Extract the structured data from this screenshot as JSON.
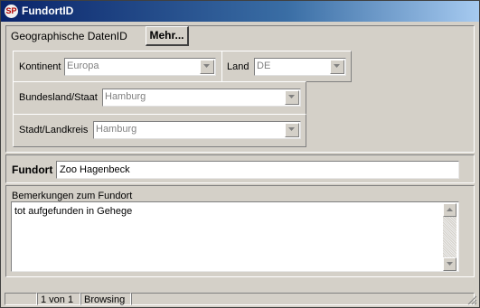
{
  "window": {
    "title": "FundortID",
    "app_icon": "sp-logo-icon"
  },
  "geo": {
    "label": "Geographische DatenID",
    "more_button": "Mehr...",
    "kontinent": {
      "label": "Kontinent",
      "value": "Europa"
    },
    "land": {
      "label": "Land",
      "value": "DE"
    },
    "bundesland": {
      "label": "Bundesland/Staat",
      "value": "Hamburg"
    },
    "stadt": {
      "label": "Stadt/Landkreis",
      "value": "Hamburg"
    }
  },
  "fundort": {
    "label": "Fundort",
    "value": "Zoo Hagenbeck"
  },
  "bemerkungen": {
    "label": "Bemerkungen zum Fundort",
    "value": "tot aufgefunden in Gehege"
  },
  "statusbar": {
    "record": "1 von 1",
    "mode": "Browsing"
  }
}
